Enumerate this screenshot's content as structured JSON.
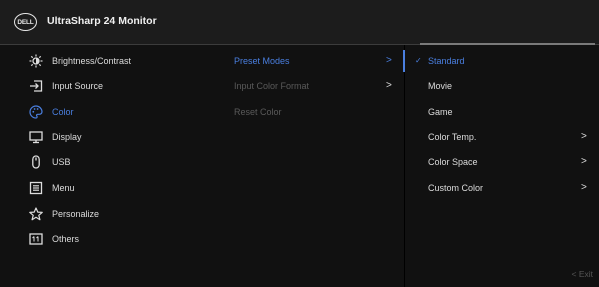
{
  "header": {
    "logo_text": "DELL",
    "title": "UltraSharp 24 Monitor"
  },
  "menu": {
    "items": [
      {
        "label": "Brightness/Contrast",
        "icon": "brightness-icon"
      },
      {
        "label": "Input Source",
        "icon": "input-source-icon"
      },
      {
        "label": "Color",
        "icon": "color-palette-icon",
        "active": true
      },
      {
        "label": "Display",
        "icon": "display-icon"
      },
      {
        "label": "USB",
        "icon": "usb-mouse-icon"
      },
      {
        "label": "Menu",
        "icon": "menu-icon"
      },
      {
        "label": "Personalize",
        "icon": "star-icon"
      },
      {
        "label": "Others",
        "icon": "others-icon"
      }
    ]
  },
  "submenu": {
    "items": [
      {
        "label": "Preset Modes",
        "chevron": ">",
        "active": true
      },
      {
        "label": "Input Color Format",
        "chevron": ">"
      },
      {
        "label": "Reset Color",
        "chevron": ""
      }
    ]
  },
  "options": {
    "items": [
      {
        "label": "Standard",
        "check": "✓",
        "active": true
      },
      {
        "label": "Movie"
      },
      {
        "label": "Game"
      },
      {
        "label": "Color Temp.",
        "chevron": ">"
      },
      {
        "label": "Color Space",
        "chevron": ">"
      },
      {
        "label": "Custom Color",
        "chevron": ">"
      }
    ]
  },
  "footer": {
    "exit_label": "< Exit"
  },
  "colors": {
    "accent": "#4a7fe0",
    "header_bg": "#1c1c1c",
    "panel_bg": "#111111"
  }
}
